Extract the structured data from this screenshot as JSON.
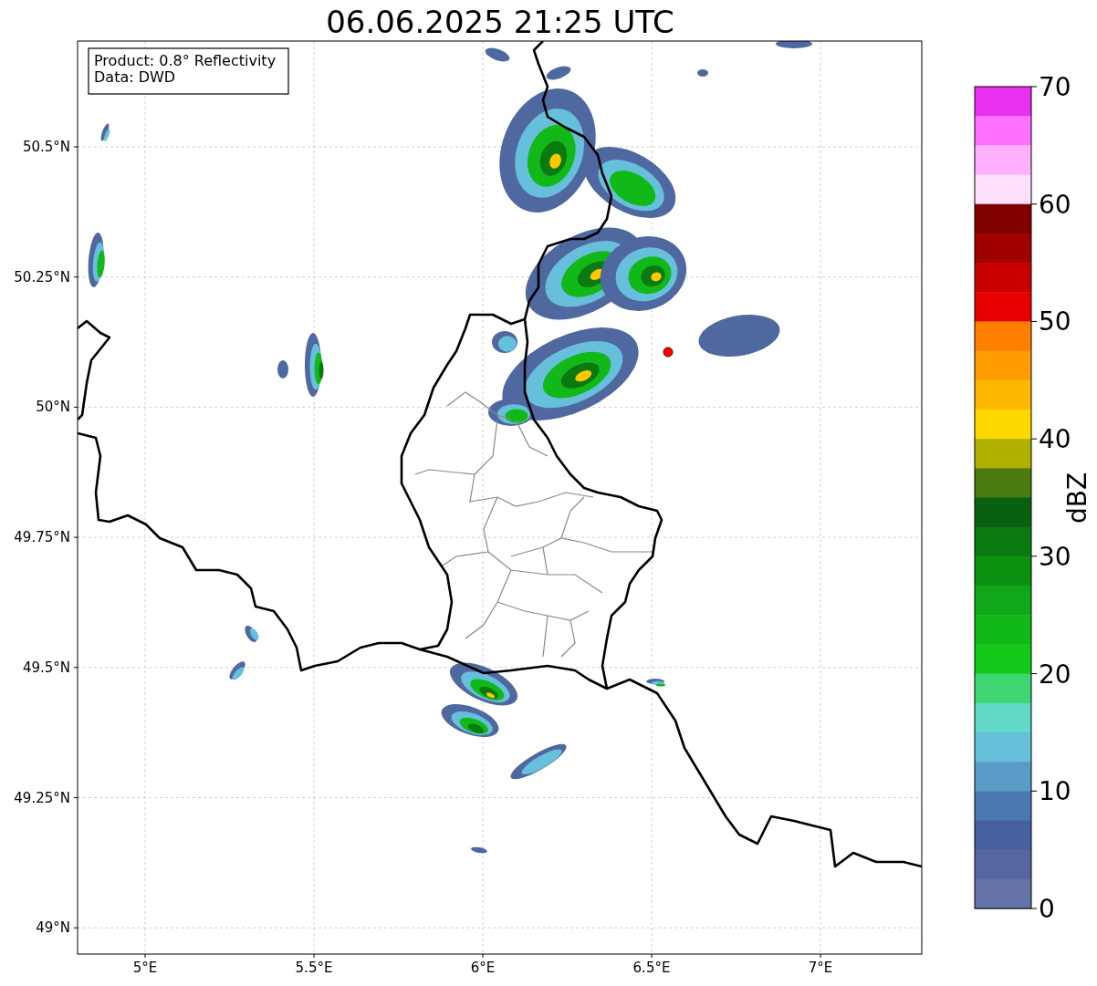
{
  "title": "06.06.2025 21:25 UTC",
  "info_box": [
    "Product: 0.8° Reflectivity",
    "Data: DWD"
  ],
  "map": {
    "lat_ticks": [
      "50.5°N",
      "50.25°N",
      "50°N",
      "49.75°N",
      "49.5°N",
      "49.25°N",
      "49°N"
    ],
    "lon_ticks": [
      "5°E",
      "5.5°E",
      "6°E",
      "6.5°E",
      "7°E"
    ]
  },
  "colorbar": {
    "label": "dBZ",
    "ticks": [
      "70",
      "60",
      "50",
      "40",
      "30",
      "20",
      "10",
      "0"
    ],
    "bands": [
      {
        "color": "#e830f0"
      },
      {
        "color": "#ff70ff"
      },
      {
        "color": "#ffb0ff"
      },
      {
        "color": "#ffe0ff"
      },
      {
        "color": "#800000"
      },
      {
        "color": "#a00000"
      },
      {
        "color": "#c80000"
      },
      {
        "color": "#e80000"
      },
      {
        "color": "#ff8000"
      },
      {
        "color": "#ff9c00"
      },
      {
        "color": "#ffb800"
      },
      {
        "color": "#ffd800"
      },
      {
        "color": "#b0b000"
      },
      {
        "color": "#4a7a10"
      },
      {
        "color": "#086010"
      },
      {
        "color": "#0a7a10"
      },
      {
        "color": "#0c9010"
      },
      {
        "color": "#10a818"
      },
      {
        "color": "#10b818"
      },
      {
        "color": "#12c818"
      },
      {
        "color": "#3ed670"
      },
      {
        "color": "#62d8c8"
      },
      {
        "color": "#66c0dc"
      },
      {
        "color": "#5a9cc8"
      },
      {
        "color": "#4a78b0"
      },
      {
        "color": "#4660a0"
      },
      {
        "color": "#5666a0"
      },
      {
        "color": "#6673a8"
      }
    ]
  }
}
